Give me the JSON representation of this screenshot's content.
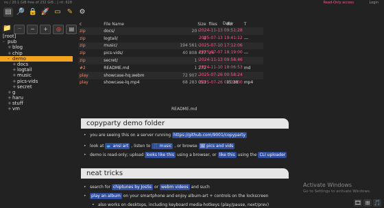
{
  "status": {
    "text": "nu / 20.1 GiB free of 232 GiB ; ▯ nt: 628",
    "readonly": "Read-Only access",
    "login": "Login"
  },
  "toolbar": {
    "icons": [
      "list-icon",
      "search-icon",
      "lock-icon",
      "rocket-icon",
      "image-icon",
      "edit-icon",
      "gear-icon"
    ]
  },
  "treectl": {
    "folder": "📁",
    "minus": "−",
    "plus": "+",
    "target": "◎",
    "file": "▤"
  },
  "tree": [
    {
      "label": "[root]",
      "pm": "",
      "indent": 0,
      "selected": false
    },
    {
      "label": "pub",
      "pm": "-",
      "indent": 0,
      "selected": false
    },
    {
      "label": "blog",
      "pm": "+",
      "indent": 1,
      "selected": false
    },
    {
      "label": "chip",
      "pm": "+",
      "indent": 1,
      "selected": false
    },
    {
      "label": "demo",
      "pm": "-",
      "indent": 1,
      "selected": true
    },
    {
      "label": "docs",
      "pm": "+",
      "indent": 2,
      "selected": false
    },
    {
      "label": "logtail",
      "pm": "+",
      "indent": 2,
      "selected": false
    },
    {
      "label": "music",
      "pm": "+",
      "indent": 2,
      "selected": false
    },
    {
      "label": "pics-vids",
      "pm": "+",
      "indent": 2,
      "selected": false
    },
    {
      "label": "secret",
      "pm": "+",
      "indent": 2,
      "selected": false
    },
    {
      "label": "g",
      "pm": "+",
      "indent": 1,
      "selected": false
    },
    {
      "label": "haru",
      "pm": "+",
      "indent": 1,
      "selected": false
    },
    {
      "label": "stuff",
      "pm": "+",
      "indent": 1,
      "selected": false
    },
    {
      "label": "vm",
      "pm": "+",
      "indent": 1,
      "selected": false
    }
  ],
  "table": {
    "headers": [
      "c",
      "File Name",
      "Size",
      "files",
      "dur",
      "T",
      "Date"
    ],
    "rows": [
      {
        "c": "zip",
        "name": "docs/",
        "size": "20 942",
        "files": "3",
        "dur": "",
        "t": "---",
        "date": "2024-11-13 09:51:28"
      },
      {
        "c": "zip",
        "name": "logtail/",
        "size": "0",
        "files": "",
        "dur": "",
        "t": "---",
        "date": "2025-07-13 19:41:12"
      },
      {
        "c": "zip",
        "name": "music/",
        "size": "194 561 068",
        "files": "140",
        "dur": "",
        "t": "---",
        "date": "2025-07-10 17:12:06"
      },
      {
        "c": "zip",
        "name": "pics-vids/",
        "size": "40 808 437",
        "files": "24",
        "dur": "",
        "t": "---",
        "date": "2025-07-07 18:19:00"
      },
      {
        "c": "zip",
        "name": "secret/",
        "size": "1 579",
        "files": "2",
        "dur": "",
        "t": "---",
        "date": "2024-11-13 09:58:46"
      },
      {
        "c": "#2",
        "name": "README.md",
        "size": "1 272",
        "files": "",
        "dur": "",
        "t": "md",
        "date": "2024-11-10 18:06:53"
      },
      {
        "c": "play",
        "name": "showcase-hq.webm",
        "size": "72 907 426",
        "files": "",
        "dur": "15:38",
        "t": "webm",
        "date": "2025-07-26 00:58:24"
      },
      {
        "c": "play",
        "name": "showcase-lq.mp4",
        "size": "68 283 053",
        "files": "",
        "dur": "15:38",
        "t": "mp4",
        "date": "2025-07-26 08:38:00"
      }
    ]
  },
  "readme_label": "README.md",
  "readme": {
    "h1": "copyparty demo folder",
    "b1_pre": "you are seeing this on a server running ",
    "b1_link": "https://github.com/9001/copyparty",
    "b2_pre": "look at ",
    "b2_l1": "🐟 ansi art",
    "b2_mid1": " , listen to ",
    "b2_l2": "🎵 music",
    "b2_mid2": " , or browse ",
    "b2_l3": "🖼 pics and vids",
    "b3_pre": "demo is read-only;  upload ",
    "b3_l1": "looks like this",
    "b3_mid": " using a browser, or ",
    "b3_l2": "like this",
    "b3_mid2": " using the ",
    "b3_l3": "CLI uploader",
    "h2": "neat tricks",
    "n1_pre": "search for ",
    "n1_l1": "chiptunes by JosSs",
    "n1_mid": " or ",
    "n1_l2": "webm videos",
    "n1_post": " and such",
    "n2_l1": "play an album",
    "n2_post": " on your smartphone and enjoy album-art + controls on the lockscreen",
    "n3": "also works on desktops, including keyboard media-hotkeys (play/pause, next/prev)"
  },
  "watermark": {
    "title": "Activate Windows",
    "sub": "Go to Settings to activate Windows."
  },
  "bottom_icons": [
    "🎞",
    "⊞",
    "🎵"
  ]
}
